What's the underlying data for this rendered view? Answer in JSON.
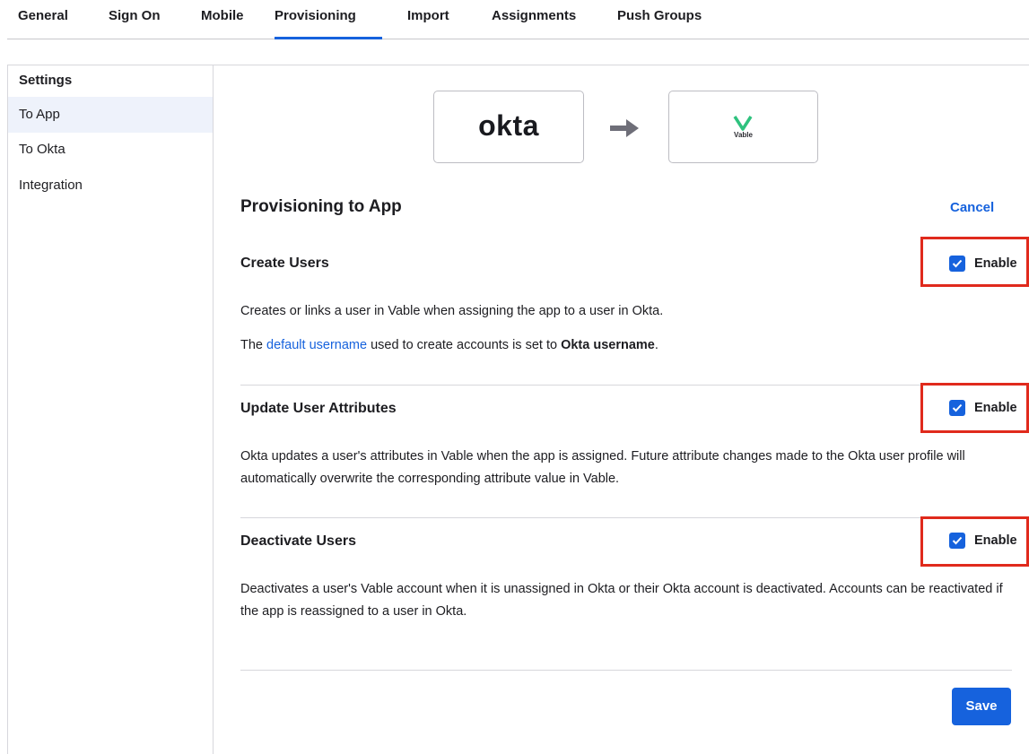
{
  "tabs": [
    {
      "label": "General",
      "active": false
    },
    {
      "label": "Sign On",
      "active": false
    },
    {
      "label": "Mobile",
      "active": false
    },
    {
      "label": "Provisioning",
      "active": true
    },
    {
      "label": "Import",
      "active": false
    },
    {
      "label": "Assignments",
      "active": false
    },
    {
      "label": "Push Groups",
      "active": false
    }
  ],
  "sidebar": {
    "heading": "Settings",
    "items": [
      {
        "label": "To App",
        "active": true
      },
      {
        "label": "To Okta",
        "active": false
      },
      {
        "label": "Integration",
        "active": false
      }
    ]
  },
  "logos": {
    "source_logo": "okta",
    "arrow_icon": "arrow-right-icon",
    "target_logo": "Vable"
  },
  "main": {
    "title": "Provisioning to App",
    "cancel_label": "Cancel",
    "save_label": "Save",
    "sections": [
      {
        "title": "Create Users",
        "enable_label": "Enable",
        "checked": true,
        "desc_1": "Creates or links a user in Vable when assigning the app to a user in Okta.",
        "desc_2_prefix": "The ",
        "desc_2_link": "default username",
        "desc_2_middle": " used to create accounts is set to ",
        "desc_2_bold": "Okta username",
        "desc_2_suffix": "."
      },
      {
        "title": "Update User Attributes",
        "enable_label": "Enable",
        "checked": true,
        "desc": "Okta updates a user's attributes in Vable when the app is assigned. Future attribute changes made to the Okta user profile will automatically overwrite the corresponding attribute value in Vable."
      },
      {
        "title": "Deactivate Users",
        "enable_label": "Enable",
        "checked": true,
        "desc": "Deactivates a user's Vable account when it is unassigned in Okta or their Okta account is deactivated. Accounts can be reactivated if the app is reassigned to a user in Okta."
      }
    ]
  },
  "colors": {
    "accent": "#1662dd",
    "highlight": "#e02a1c",
    "active_bg": "#eef2fb",
    "vable_brand": "#2ec27e"
  }
}
